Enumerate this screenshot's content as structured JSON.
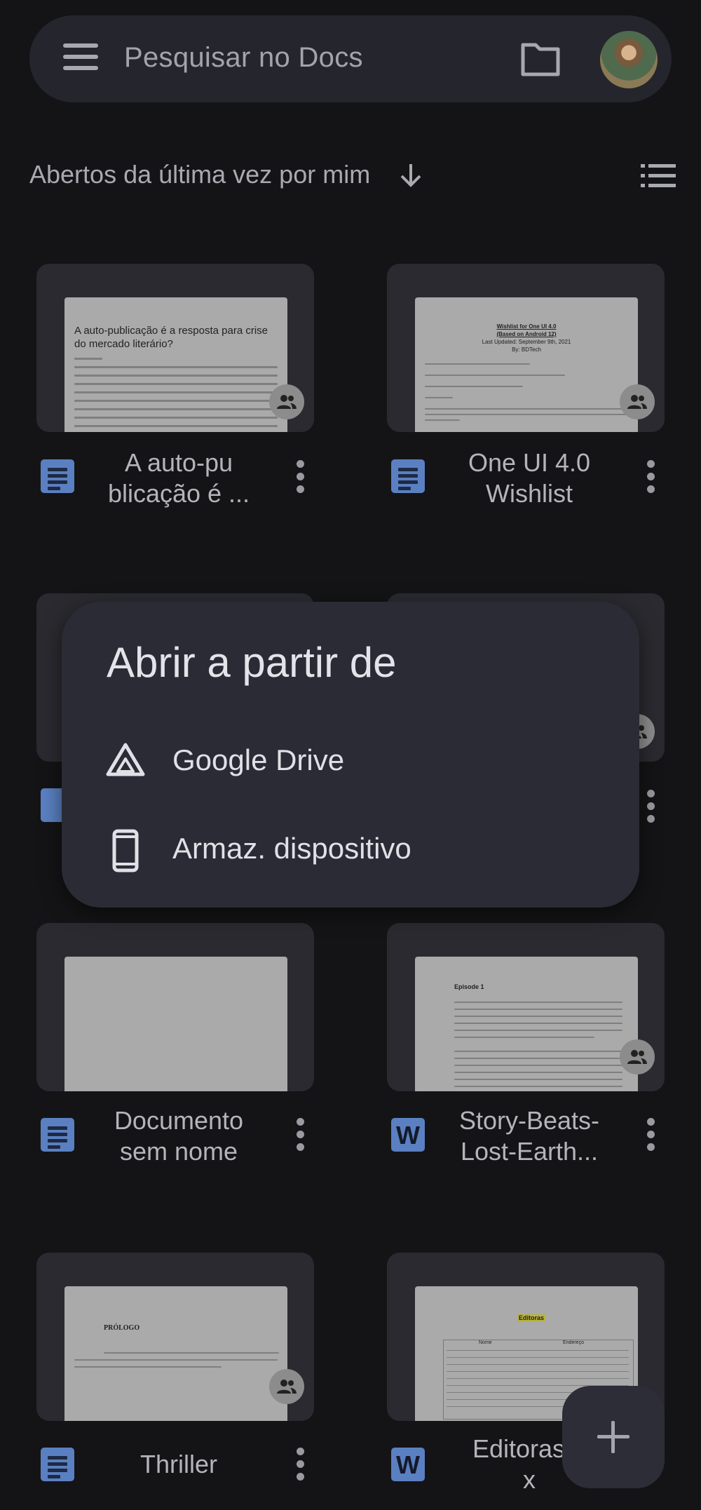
{
  "search": {
    "placeholder": "Pesquisar no Docs"
  },
  "sort": {
    "label": "Abertos da última vez por mim"
  },
  "documents": [
    {
      "name": "A auto-pu\nblicação é ...",
      "name_line1": "A auto-pu",
      "name_line2": "blicação é ...",
      "type": "docs",
      "shared": true,
      "preview_title": "A auto-publicação é a resposta para crise do mercado literário?"
    },
    {
      "name_line1": "One UI 4.0",
      "name_line2": "Wishlist",
      "type": "docs",
      "shared": true,
      "preview_title": "Wishlist for One UI 4.0",
      "preview_subtitle": "(Based on Android 12)",
      "preview_updated": "Last Updated: September 9th, 2021",
      "preview_by": "By: BDTech"
    },
    {
      "name_line1": "Documento",
      "name_line2": "sem nome",
      "type": "docs",
      "shared": false
    },
    {
      "name_line1": "Story-Beats-",
      "name_line2": "Lost-Earth...",
      "type": "word",
      "shared": true,
      "preview_title": "Episode 1"
    },
    {
      "name_line1": "Thriller",
      "name_line2": "",
      "type": "docs",
      "shared": true,
      "preview_title": "PRÓLOGO"
    },
    {
      "name_line1": "Editoras.d",
      "name_line2": "x",
      "type": "word",
      "shared": true,
      "preview_title": "Editoras",
      "preview_col1": "Nome",
      "preview_col2": "Endereço"
    }
  ],
  "dialog": {
    "title": "Abrir a partir de",
    "options": [
      {
        "label": "Google Drive",
        "icon": "google-drive-icon"
      },
      {
        "label": "Armaz. dispositivo",
        "icon": "smartphone-icon"
      }
    ]
  },
  "fab": {
    "icon": "plus-icon"
  }
}
